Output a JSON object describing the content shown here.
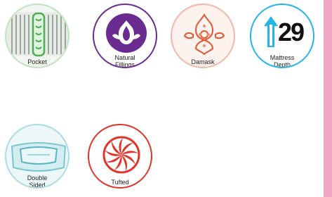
{
  "features": {
    "pocket": {
      "label": "Pocket",
      "icon": "pocket-spring-icon",
      "color": "#8fcf8f"
    },
    "natural_fillings": {
      "label_line1": "Natural",
      "label_line2": "Fillings",
      "icon": "flower-icon",
      "color": "#6a2c91"
    },
    "damask": {
      "label": "Damask",
      "icon": "damask-pattern-icon",
      "color": "#e8816b"
    },
    "mattress_depth": {
      "label_line1": "Mattress",
      "label_line2": "Depth",
      "value": "29",
      "icon": "depth-arrow-icon",
      "color": "#23b5e8"
    },
    "double_sided": {
      "label_line1": "Double",
      "label_line2": "Sided",
      "icon": "double-sided-mattress-icon",
      "color": "#6fc3cf"
    },
    "tufted": {
      "label": "Tufted",
      "icon": "tufted-swirl-icon",
      "color": "#e2332a"
    }
  },
  "side_strip_color": "#f2a7c5"
}
